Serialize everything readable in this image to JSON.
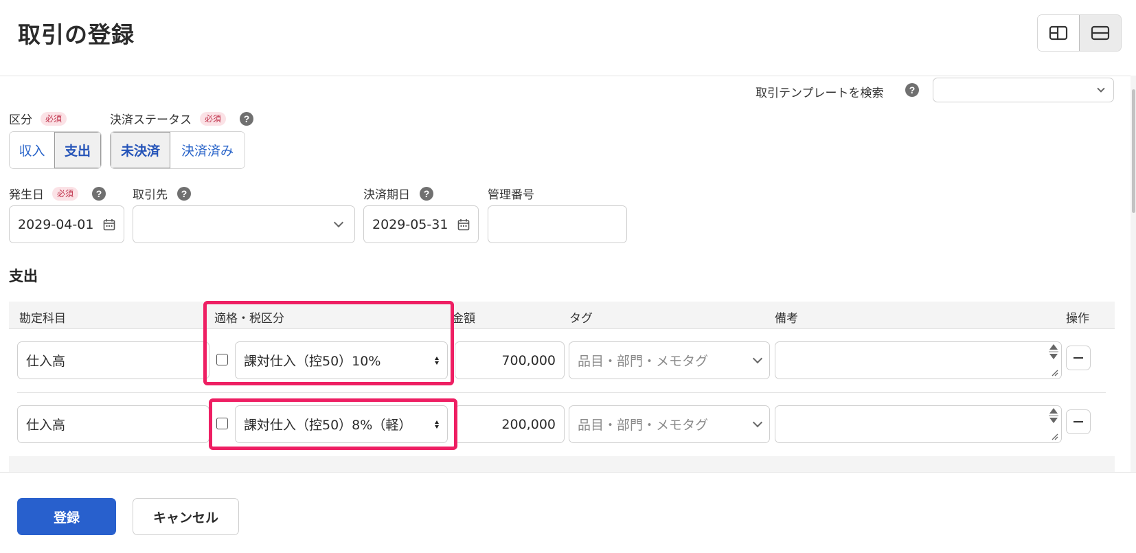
{
  "page": {
    "title": "取引の登録"
  },
  "template_search": {
    "label": "取引テンプレートを検索",
    "help": "?",
    "value": ""
  },
  "kubun": {
    "label": "区分",
    "required": "必須",
    "options": [
      "収入",
      "支出"
    ],
    "selected": "支出"
  },
  "status": {
    "label": "決済ステータス",
    "required": "必須",
    "help": "?",
    "options": [
      "未決済",
      "決済済み"
    ],
    "selected": "未決済"
  },
  "hassei_date": {
    "label": "発生日",
    "required": "必須",
    "help": "?",
    "value": "2029-04-01"
  },
  "partner": {
    "label": "取引先",
    "help": "?",
    "value": ""
  },
  "due_date": {
    "label": "決済期日",
    "help": "?",
    "value": "2029-05-31"
  },
  "control_no": {
    "label": "管理番号",
    "value": ""
  },
  "section": {
    "title": "支出"
  },
  "table": {
    "headers": {
      "account": "勘定科目",
      "tax": "適格・税区分",
      "amount": "金額",
      "tag": "タグ",
      "memo": "備考",
      "ops": "操作"
    },
    "rows": [
      {
        "account": "仕入高",
        "tax": "課対仕入（控50）10%",
        "amount": "700,000",
        "tag_placeholder": "品目・部門・メモタグ",
        "memo": ""
      },
      {
        "account": "仕入高",
        "tax": "課対仕入（控50）8%（軽）",
        "amount": "200,000",
        "tag_placeholder": "品目・部門・メモタグ",
        "memo": ""
      }
    ]
  },
  "footer": {
    "submit": "登録",
    "cancel": "キャンセル"
  },
  "colors": {
    "primary": "#2860cd",
    "highlight": "#ee1f63",
    "required_text": "#c0324b",
    "link": "#2964c9"
  }
}
